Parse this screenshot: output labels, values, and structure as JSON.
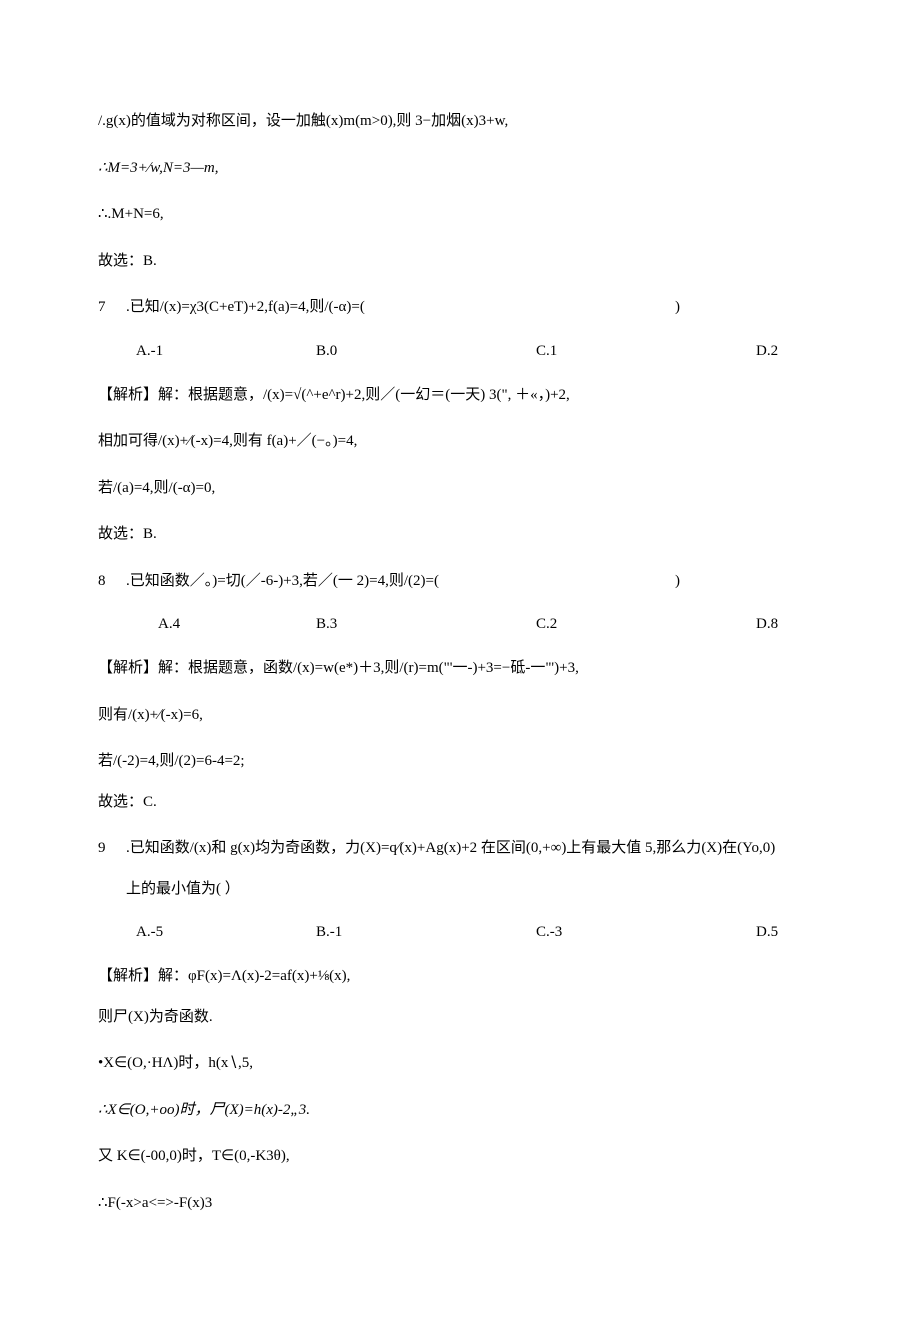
{
  "lines": {
    "l1": "/.g(x)的值域为对称区间，设一加触(x)m(m>0),则 3−加烟(x)3+w,",
    "l2": "∴M=3+∕w,N=3—m,",
    "l3": "∴.M+N=6,",
    "l4": "故选：B.",
    "q7_num": "7",
    "q7_stem": ".已知/(x)=χ3(C+eT)+2,f(a)=4,则/(-α)=(",
    "q7_close": ")",
    "q7_a": "A.-1",
    "q7_b": "B.0",
    "q7_c": "C.1",
    "q7_d": "D.2",
    "l5": "【解析】解：根据题意，/(x)=√(^+e^r)+2,则／(一幻＝(一天) 3(\", ＋«，)+2,",
    "l6": "相加可得/(x)+∕(-x)=4,则有 f(a)+／(−。)=4,",
    "l7": "若/(a)=4,则/(-α)=0,",
    "l8": "故选：B.",
    "q8_num": "8",
    "q8_stem": ".已知函数／。)=切(／-6-)+3,若／(一 2)=4,则/(2)=(",
    "q8_close": ")",
    "q8_a": "A.4",
    "q8_b": "B.3",
    "q8_c": "C.2",
    "q8_d": "D.8",
    "l9": "【解析】解：根据题意，函数/(x)=w(e*)＋3,则/(r)=m(\"'一-)+3=−砥-一\"')+3,",
    "l10": "则有/(x)+∕(-x)=6,",
    "l11": "若/(-2)=4,则/(2)=6-4=2;",
    "l12": "故选：C.",
    "q9_num": "9",
    "q9_stem_a": ".已知函数/(x)和 g(x)均为奇函数，力(X)=q∕(x)+Ag(x)+2 在区间(0,+∞)上有最大值 5,那么力(X)在(Yo,0)",
    "q9_stem_b": "上的最小值为(          ）",
    "q9_a": "A.-5",
    "q9_b": "B.-1",
    "q9_c": "C.-3",
    "q9_d": "D.5",
    "l13": "【解析】解：φF(x)=Λ(x)-2=af(x)+⅛(x),",
    "l14": "则尸(X)为奇函数.",
    "l15": "•X∈(O,·HΛ)时，h(x∖,5,",
    "l16": "∴X∈(O,+oo)时，尸(X)=h(x)-2„3.",
    "l17": "又 K∈(-00,0)时，T∈(0,-K3θ),",
    "l18": "∴F(-x>a<=>-F(x)3"
  }
}
